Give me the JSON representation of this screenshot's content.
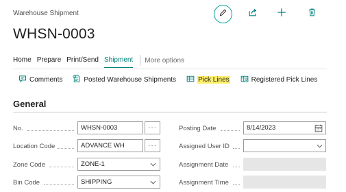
{
  "header": {
    "caption": "Warehouse Shipment",
    "title": "WHSN-0003"
  },
  "header_actions": [
    "edit-icon",
    "share-icon",
    "add-icon",
    "delete-icon"
  ],
  "tabs": {
    "home": "Home",
    "prepare": "Prepare",
    "print_send": "Print/Send",
    "shipment": "Shipment",
    "more": "More options"
  },
  "commands": {
    "comments": "Comments",
    "posted": "Posted Warehouse Shipments",
    "pick_lines": "Pick Lines",
    "registered": "Registered Pick Lines"
  },
  "section": {
    "title": "General"
  },
  "fields": {
    "no": {
      "label": "No.",
      "value": "WHSN-0003",
      "action": "···"
    },
    "location": {
      "label": "Location Code",
      "value": "ADVANCE WH",
      "action": "···"
    },
    "zone": {
      "label": "Zone Code",
      "value": "ZONE-1"
    },
    "bin": {
      "label": "Bin Code",
      "value": "SHIPPING"
    },
    "posting_date": {
      "label": "Posting Date",
      "value": "8/14/2023"
    },
    "assigned_user": {
      "label": "Assigned User ID",
      "value": ""
    },
    "assignment_date": {
      "label": "Assignment Date",
      "value": ""
    },
    "assignment_time": {
      "label": "Assignment Time",
      "value": ""
    }
  },
  "colors": {
    "accent": "#00807a",
    "highlight": "#fff06a"
  }
}
